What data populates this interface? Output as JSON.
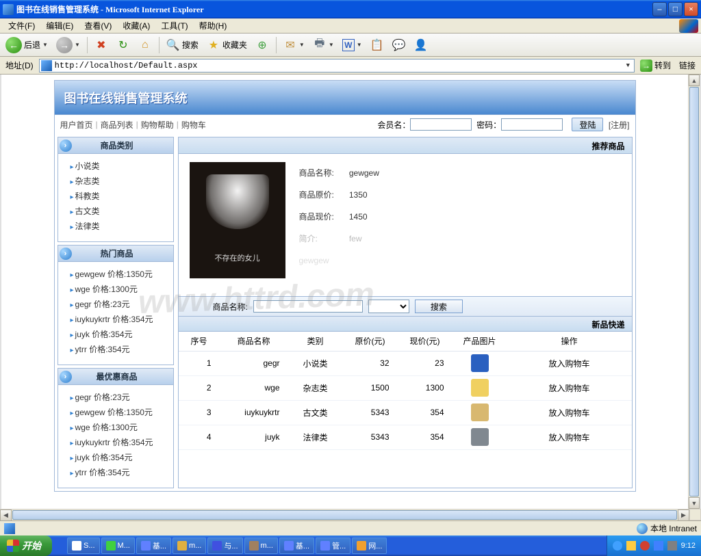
{
  "window": {
    "title": "图书在线销售管理系统 - Microsoft Internet Explorer",
    "minLabel": "–",
    "maxLabel": "□",
    "closeLabel": "×"
  },
  "menubar": {
    "file": "文件(F)",
    "edit": "编辑(E)",
    "view": "查看(V)",
    "favorites": "收藏(A)",
    "tools": "工具(T)",
    "help": "帮助(H)"
  },
  "toolbar": {
    "back": "后退",
    "search": "搜索",
    "favorites": "收藏夹"
  },
  "addressbar": {
    "label": "地址(D)",
    "url": "http://localhost/Default.aspx",
    "go": "转到",
    "links": "链接"
  },
  "app": {
    "title": "图书在线销售管理系统",
    "nav": {
      "home": "用户首页",
      "list": "商品列表",
      "help": "购物帮助",
      "cart": "购物车"
    },
    "login": {
      "userLabel": "会员名：",
      "pwdLabel": "密码：",
      "loginBtn": "登陆",
      "registerBtn": "[注册]"
    },
    "panel_category": {
      "title": "商品类别",
      "items": [
        "小说类",
        "杂志类",
        "科教类",
        "古文类",
        "法律类"
      ]
    },
    "panel_hot": {
      "title": "热门商品",
      "items": [
        "gewgew 价格:1350元",
        "wge 价格:1300元",
        "gegr 价格:23元",
        "iuykuykrtr 价格:354元",
        "juyk 价格:354元",
        "ytrr 价格:354元"
      ]
    },
    "panel_deal": {
      "title": "最优惠商品",
      "items": [
        "gegr 价格:23元",
        "gewgew 价格:1350元",
        "wge 价格:1300元",
        "iuykuykrtr 价格:354元",
        "juyk 价格:354元",
        "ytrr 价格:354元"
      ]
    },
    "recommend": {
      "header": "推荐商品",
      "nameLabel": "商品名称:",
      "nameValue": "gewgew",
      "origLabel": "商品原价:",
      "origValue": "1350",
      "nowLabel": "商品现价:",
      "nowValue": "1450",
      "descLabel": "简介:",
      "descValue": "few",
      "imgCaption": "不存在的女儿",
      "imgCaption2": "gewgew"
    },
    "searchRow": {
      "label": "商品名称:",
      "button": "搜索"
    },
    "newHeader": "新品快递",
    "grid": {
      "cols": {
        "no": "序号",
        "name": "商品名称",
        "cat": "类别",
        "orig": "原价(元)",
        "now": "现价(元)",
        "img": "产品图片",
        "act": "操作"
      },
      "rows": [
        {
          "no": "1",
          "name": "gegr",
          "cat": "小说类",
          "orig": "32",
          "now": "23",
          "color": "#2a60c0",
          "act": "放入购物车"
        },
        {
          "no": "2",
          "name": "wge",
          "cat": "杂志类",
          "orig": "1500",
          "now": "1300",
          "color": "#f0d060",
          "act": "放入购物车"
        },
        {
          "no": "3",
          "name": "iuykuykrtr",
          "cat": "古文类",
          "orig": "5343",
          "now": "354",
          "color": "#d8b870",
          "act": "放入购物车"
        },
        {
          "no": "4",
          "name": "juyk",
          "cat": "法律类",
          "orig": "5343",
          "now": "354",
          "color": "#808890",
          "act": "放入购物车"
        }
      ]
    }
  },
  "statusbar": {
    "zone": "本地 Intranet"
  },
  "taskbar": {
    "start": "开始",
    "items": [
      {
        "label": "S...",
        "color": "#ffffff"
      },
      {
        "label": "M...",
        "color": "#40d040"
      },
      {
        "label": "基...",
        "color": "#6080ff"
      },
      {
        "label": "m...",
        "color": "#e0b040"
      },
      {
        "label": "与...",
        "color": "#4050e0"
      },
      {
        "label": "m...",
        "color": "#a08060"
      },
      {
        "label": "基...",
        "color": "#6080ff"
      },
      {
        "label": "管...",
        "color": "#6080ff"
      },
      {
        "label": "网...",
        "color": "#f0a030"
      }
    ],
    "clock": "9:12"
  },
  "watermark": "www.httrd.com"
}
